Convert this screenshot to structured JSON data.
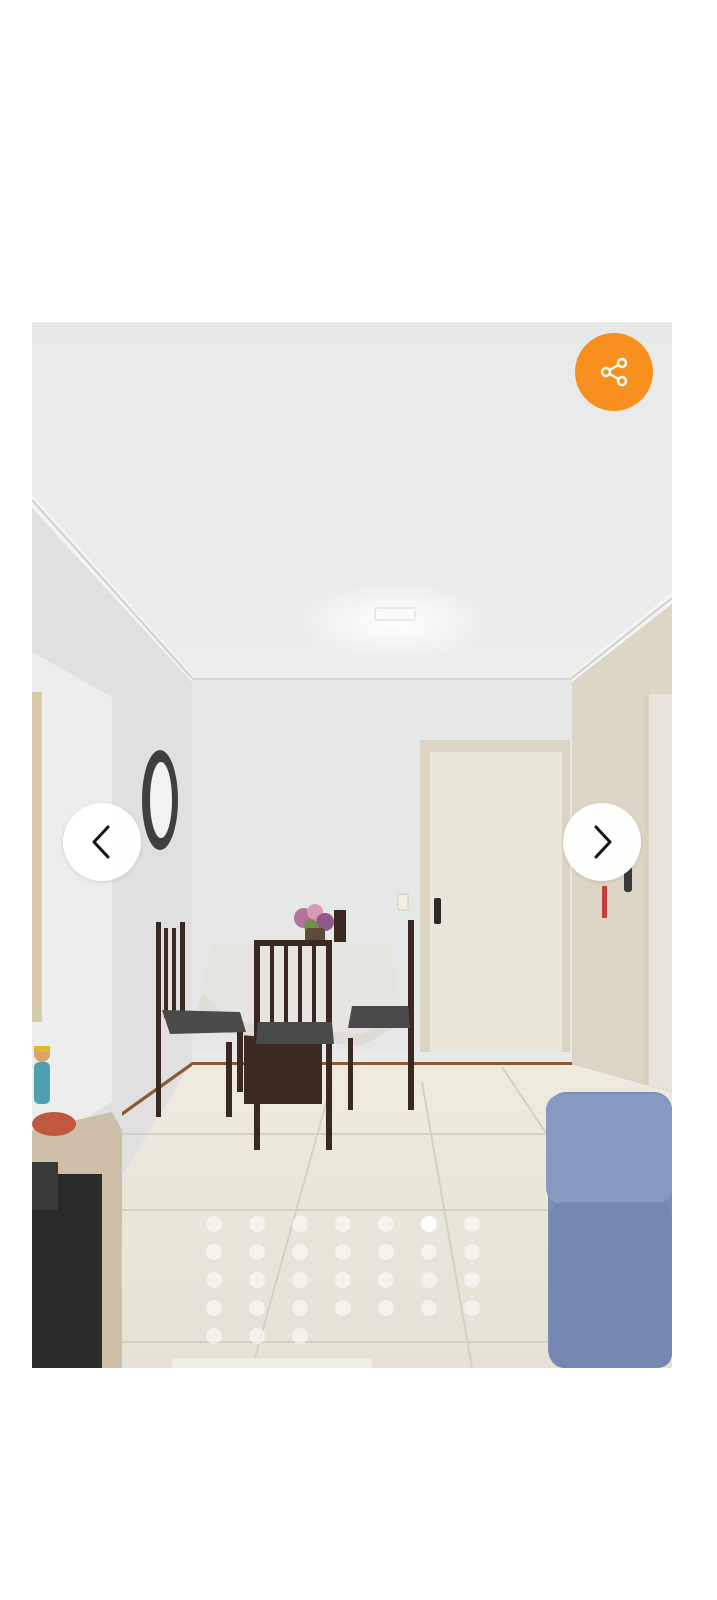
{
  "gallery": {
    "photo_subject": "living-dining-room-interior",
    "share_button": {
      "icon": "share-icon",
      "color": "#F7901E"
    },
    "prev_button": {
      "icon": "chevron-left-icon"
    },
    "next_button": {
      "icon": "chevron-right-icon"
    },
    "pagination": {
      "dot_count": 31,
      "active_index": 5
    }
  }
}
